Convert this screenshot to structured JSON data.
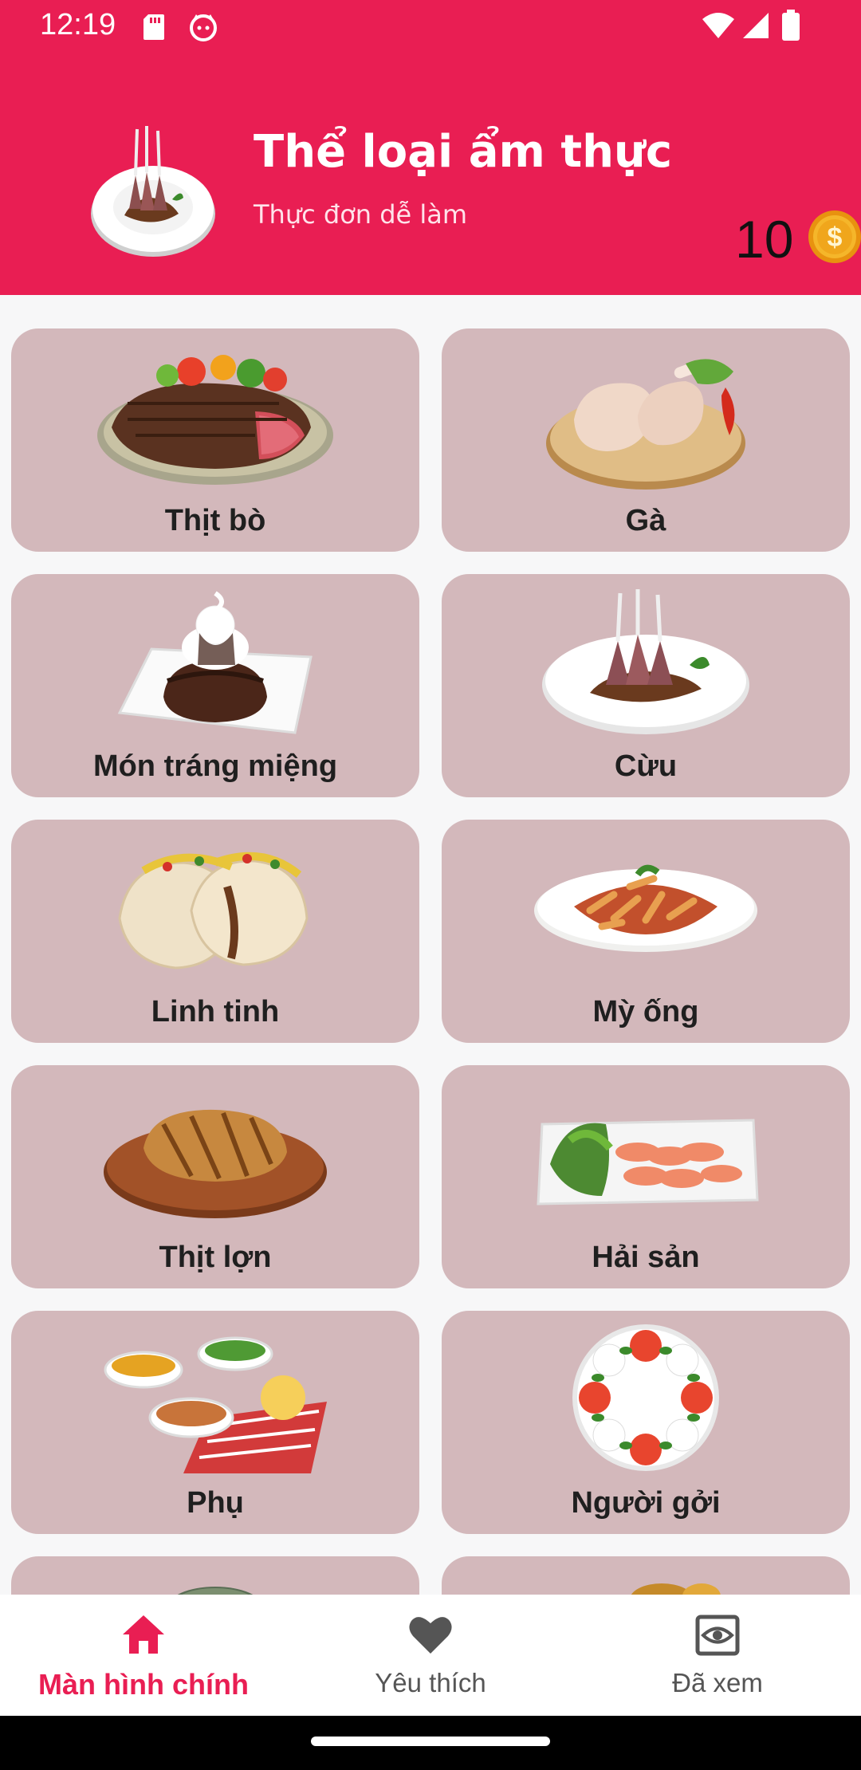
{
  "status": {
    "time": "12:19"
  },
  "header": {
    "title": "Thể loại ẩm thực",
    "subtitle": "Thực đơn dễ làm",
    "coins": "10",
    "plate_icon": "lamb-plate-icon",
    "coin_icon": "gold-coin-dollar-icon"
  },
  "categories": [
    {
      "label": "Thịt bò",
      "icon": "steak-icon"
    },
    {
      "label": "Gà",
      "icon": "raw-chicken-icon"
    },
    {
      "label": "Món tráng miệng",
      "icon": "dessert-icon"
    },
    {
      "label": "Cừu",
      "icon": "lamb-rack-icon"
    },
    {
      "label": "Linh tinh",
      "icon": "taco-icon"
    },
    {
      "label": "Mỳ ống",
      "icon": "pasta-icon"
    },
    {
      "label": "Thịt lợn",
      "icon": "pork-chop-icon"
    },
    {
      "label": "Hải sản",
      "icon": "salmon-icon"
    },
    {
      "label": "Phụ",
      "icon": "side-dishes-icon"
    },
    {
      "label": "Người gởi",
      "icon": "caprese-icon"
    }
  ],
  "nav": {
    "items": [
      {
        "label": "Màn hình chính",
        "icon": "home-icon",
        "active": true
      },
      {
        "label": "Yêu thích",
        "icon": "heart-icon",
        "active": false
      },
      {
        "label": "Đã xem",
        "icon": "eye-icon",
        "active": false
      }
    ]
  },
  "colors": {
    "primary": "#e91e53",
    "card_bg": "#d3b8bb",
    "page_bg": "#f7f7f8",
    "coin": "#f5a623"
  }
}
